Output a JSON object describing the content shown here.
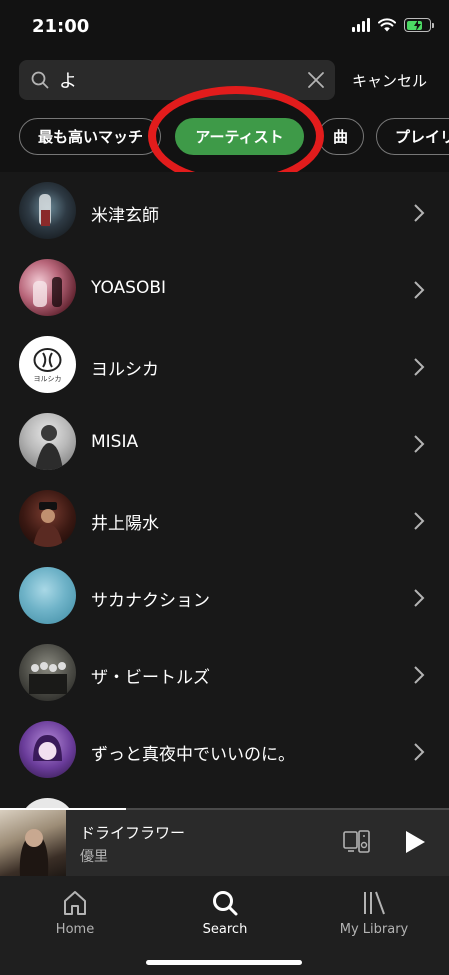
{
  "status_bar": {
    "time": "21:00",
    "battery_level": 0.7
  },
  "search": {
    "query": "よ",
    "placeholder": "",
    "cancel_label": "キャンセル"
  },
  "filters": [
    {
      "label": "最も高いマッチ",
      "active": false
    },
    {
      "label": "アーティスト",
      "active": true
    },
    {
      "label": "曲",
      "active": false
    },
    {
      "label": "プレイリ",
      "active": false
    }
  ],
  "results": [
    {
      "name": "米津玄師"
    },
    {
      "name": "YOASOBI"
    },
    {
      "name": "ヨルシカ",
      "logo_text": "ヨルシカ"
    },
    {
      "name": "MISIA"
    },
    {
      "name": "井上陽水"
    },
    {
      "name": "サカナクション"
    },
    {
      "name": "ザ・ビートルズ"
    },
    {
      "name": "ずっと真夜中でいいのに。"
    }
  ],
  "now_playing": {
    "title": "ドライフラワー",
    "artist": "優里",
    "progress": 0.28
  },
  "tab_bar": {
    "items": [
      {
        "label": "Home",
        "icon": "home-icon",
        "active": false
      },
      {
        "label": "Search",
        "icon": "search-icon",
        "active": true
      },
      {
        "label": "My Library",
        "icon": "library-icon",
        "active": false
      }
    ]
  },
  "colors": {
    "accent_green": "#3e9a48",
    "highlight_red": "#e21c1c",
    "background": "#121212"
  }
}
